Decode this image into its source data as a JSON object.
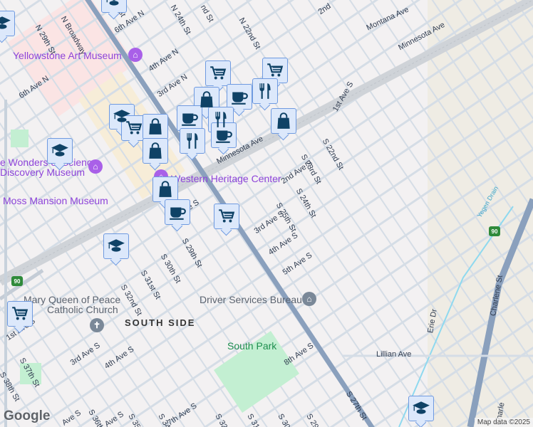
{
  "map": {
    "districts": [
      "SOUTH SIDE"
    ],
    "poi": {
      "yellowstone": "Yellowstone Art Museum",
      "wonders1": "e Wonders of Science",
      "wonders2": "Discovery Museum",
      "moss": "Moss Mansion Museum",
      "western": "Western Heritage Center",
      "mary1": "Mary Queen of Peace",
      "mary2": "Catholic Church",
      "driver": "Driver Services Bureau",
      "southpark": "South Park"
    },
    "streets": {
      "n29": "N 29th St",
      "nbroad": "N Broadway",
      "sixthN_a": "6th Ave N",
      "sixthN_b": "6th Ave N",
      "fourthN": "4th Ave N",
      "thirdN": "3rd Ave N",
      "n24": "N 24th St",
      "n22": "N 22nd St",
      "second": "2nd",
      "montana": "Montana Ave",
      "minnesota_a": "Minnesota Ave",
      "minnesota_b": "Minnesota Ave",
      "firstS_a": "1st Ave S",
      "firstS_b": "1st Ave S",
      "firstS_c": "st Ave S",
      "s22": "S 22nd St",
      "s23": "S 23rd St",
      "s24": "S 24th St",
      "s25": "S 25th St",
      "secondS": "2nd Ave S",
      "thirdS_a": "3rd Ave S",
      "fourthS_a": "4th Ave S",
      "fifthS": "5th Ave S",
      "s29_a": "S 29th St",
      "s30_a": "S 30th St",
      "s31_a": "S 31st St",
      "s32_a": "S 32nd St",
      "thirdS_b": "3rd Ave S",
      "fourthS_b": "4th Ave S",
      "s37": "S 37th St",
      "s38": "S 38th St",
      "eighthS": "8th Ave S",
      "seventhS": "7th Ave S",
      "s27": "S 27th St",
      "lillian": "Lillian Ave",
      "erie": "Erie Dr",
      "charlene_a": "Charlene St",
      "charlene_b": "Charle",
      "yegen": "Yegen Drain",
      "s36": "S 36th St",
      "s35": "S 35th",
      "s34": "S 34th",
      "s32_b": "S 32nd",
      "s31_b": "S 31st",
      "s30_b": "S 30th",
      "s29_b": "S 29th",
      "aveS_a": "Ave S",
      "aveS_b": "Ave S",
      "st_top": "St",
      "nd_top": "nd St"
    },
    "shields": {
      "i90_a": "90",
      "i90_b": "90"
    },
    "pins": [
      "cart",
      "cart",
      "cart",
      "cart",
      "cart",
      "bag",
      "bag",
      "bag",
      "bag",
      "cup",
      "cup",
      "cup",
      "fork",
      "fork",
      "fork",
      "school",
      "school",
      "school",
      "school"
    ],
    "google_logo": "Google",
    "attribution": "Map data ©2025",
    "colors": {
      "pin_fill": "#dce8fb",
      "pin_icon": "#0f4266",
      "poi_purple": "#8e44d9",
      "highway": "#8aa0bd",
      "park": "#c3efd2"
    }
  }
}
